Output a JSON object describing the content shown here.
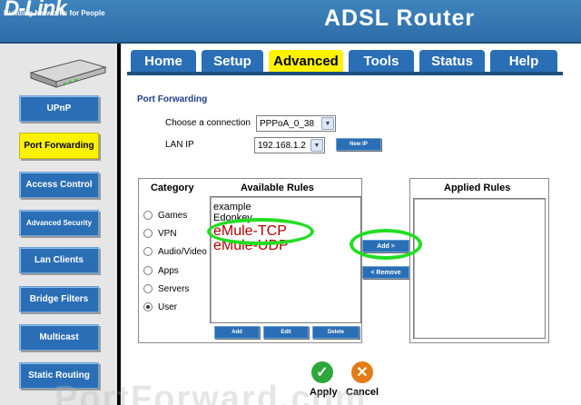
{
  "header": {
    "logo": "D-Link",
    "tagline": "Building Networks for People",
    "model": "ADSL Router"
  },
  "sidebar": {
    "items": [
      {
        "label": "UPnP",
        "active": false
      },
      {
        "label": "Port Forwarding",
        "active": true
      },
      {
        "label": "Access Control",
        "active": false
      },
      {
        "label": "Advanced Security",
        "active": false
      },
      {
        "label": "Lan Clients",
        "active": false
      },
      {
        "label": "Bridge Filters",
        "active": false
      },
      {
        "label": "Multicast",
        "active": false
      },
      {
        "label": "Static Routing",
        "active": false
      }
    ]
  },
  "tabs": [
    {
      "label": "Home"
    },
    {
      "label": "Setup"
    },
    {
      "label": "Advanced"
    },
    {
      "label": "Tools"
    },
    {
      "label": "Status"
    },
    {
      "label": "Help"
    }
  ],
  "main": {
    "title": "Port Forwarding",
    "connection_label": "Choose a connection",
    "connection_value": "PPPoA_0_38",
    "lan_ip_label": "LAN IP",
    "lan_ip_value": "192.168.1.2",
    "new_ip_button": "New IP",
    "category_header": "Category",
    "available_header": "Available Rules",
    "applied_header": "Applied Rules",
    "categories": [
      "Games",
      "VPN",
      "Audio/Video",
      "Apps",
      "Servers",
      "User"
    ],
    "selected_category": "User",
    "available_rules": [
      "example",
      "Edonkey",
      "eMule-TCP",
      "eMule-UDP"
    ],
    "add_button": "Add",
    "edit_button": "Edit",
    "delete_button": "Delete",
    "add_rule_button": "Add >",
    "remove_rule_button": "< Remove",
    "apply_label": "Apply",
    "cancel_label": "Cancel"
  },
  "watermark": "PortForward.com",
  "colors": {
    "brand_blue": "#2a6eb5",
    "active_yellow": "#fff200",
    "highlight_green": "#22dd22"
  }
}
